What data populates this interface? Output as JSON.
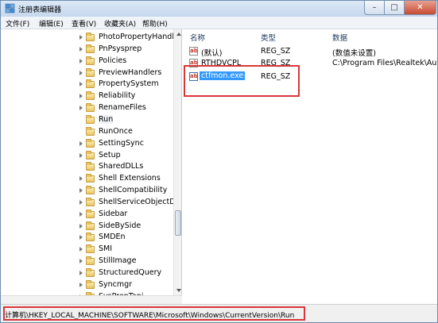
{
  "window": {
    "title": "注册表编辑器",
    "controls": {
      "minimize": "–",
      "maximize": "□",
      "close": "✕"
    }
  },
  "menu": [
    "文件(F)",
    "编辑(E)",
    "查看(V)",
    "收藏夹(A)",
    "帮助(H)"
  ],
  "tree": {
    "items": [
      {
        "label": "PhotoPropertyHandle",
        "expandable": true
      },
      {
        "label": "PnPsysprep",
        "expandable": true
      },
      {
        "label": "Policies",
        "expandable": true
      },
      {
        "label": "PreviewHandlers",
        "expandable": true
      },
      {
        "label": "PropertySystem",
        "expandable": true
      },
      {
        "label": "Reliability",
        "expandable": true
      },
      {
        "label": "RenameFiles",
        "expandable": true
      },
      {
        "label": "Run",
        "expandable": false,
        "selected": true
      },
      {
        "label": "RunOnce",
        "expandable": false
      },
      {
        "label": "SettingSync",
        "expandable": true
      },
      {
        "label": "Setup",
        "expandable": true
      },
      {
        "label": "SharedDLLs",
        "expandable": false
      },
      {
        "label": "Shell Extensions",
        "expandable": true
      },
      {
        "label": "ShellCompatibility",
        "expandable": true
      },
      {
        "label": "ShellServiceObjectDel",
        "expandable": true
      },
      {
        "label": "Sidebar",
        "expandable": true
      },
      {
        "label": "SideBySide",
        "expandable": true
      },
      {
        "label": "SMDEn",
        "expandable": true
      },
      {
        "label": "SMI",
        "expandable": true
      },
      {
        "label": "StillImage",
        "expandable": true
      },
      {
        "label": "StructuredQuery",
        "expandable": true
      },
      {
        "label": "Syncmgr",
        "expandable": true
      },
      {
        "label": "SysPrepTapi",
        "expandable": true
      }
    ]
  },
  "list": {
    "headers": {
      "name": "名称",
      "type": "类型",
      "data": "数据"
    },
    "rows": [
      {
        "name": "(默认)",
        "type": "REG_SZ",
        "data": "(数值未设置)",
        "icon": "ab"
      },
      {
        "name": "RTHDVCPL",
        "type": "REG_SZ",
        "data": "C:\\Program Files\\Realtek\\Aud",
        "icon": "ab"
      },
      {
        "name": "ctfmon.exe",
        "type": "REG_SZ",
        "data": "",
        "icon": "ab",
        "selected": true
      }
    ]
  },
  "status": {
    "path": "计算机\\HKEY_LOCAL_MACHINE\\SOFTWARE\\Microsoft\\Windows\\CurrentVersion\\Run"
  },
  "colors": {
    "highlight_box": "#d8373a",
    "selection": "#3399ff",
    "window_border": "#6f8db0"
  }
}
